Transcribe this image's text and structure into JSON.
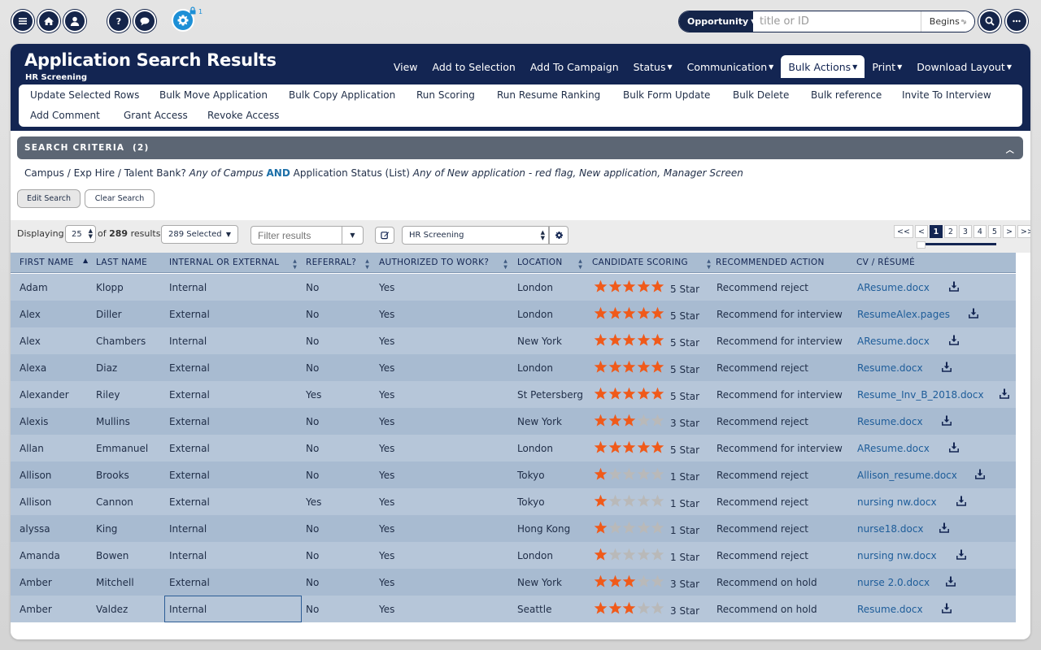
{
  "search": {
    "entity": "Opportunity",
    "placeholder": "title or ID",
    "mode": "Begins"
  },
  "top_icons": [
    "menu-icon",
    "home-icon",
    "user-icon",
    "help-icon",
    "chat-icon",
    "settings-icon"
  ],
  "lock_badge": "1",
  "header": {
    "title": "Application Search Results",
    "subtitle": "HR Screening",
    "menu": [
      {
        "label": "View",
        "caret": false
      },
      {
        "label": "Add to Selection",
        "caret": false
      },
      {
        "label": "Add To Campaign",
        "caret": false
      },
      {
        "label": "Status",
        "caret": true
      },
      {
        "label": "Communication",
        "caret": true
      },
      {
        "label": "Bulk Actions",
        "caret": true,
        "active": true
      },
      {
        "label": "Print",
        "caret": true
      },
      {
        "label": "Download Layout",
        "caret": true
      }
    ]
  },
  "bulk_actions": [
    "Update Selected Rows",
    "Bulk Move Application",
    "Bulk Copy Application",
    "Run Scoring",
    "Run Resume Ranking",
    "Bulk Form Update",
    "Bulk Delete",
    "Bulk reference",
    "Invite To Interview",
    "Add Comment",
    "Grant Access",
    "Revoke Access"
  ],
  "criteria": {
    "heading": "SEARCH CRITERIA",
    "count": "(2)",
    "field1": "Campus / Exp Hire / Talent Bank?",
    "op1": "Any of",
    "val1": "Campus",
    "conj": "AND",
    "field2": "Application Status (List)",
    "op2": "Any of",
    "val2": "New application - red flag, New application, Manager Screen",
    "edit": "Edit Search",
    "clear": "Clear Search"
  },
  "toolbar": {
    "displaying": "Displaying",
    "per_page": "25",
    "of": "of",
    "total": "289",
    "results": "results",
    "selected": "289 Selected",
    "filter_placeholder": "Filter results",
    "view": "HR Screening",
    "pages": [
      "<<",
      "<",
      "1",
      "2",
      "3",
      "4",
      "5",
      ">",
      ">>"
    ],
    "current_page": "1"
  },
  "columns": [
    "FIRST NAME",
    "LAST NAME",
    "INTERNAL OR EXTERNAL",
    "REFERRAL?",
    "AUTHORIZED TO WORK?",
    "LOCATION",
    "CANDIDATE SCORING",
    "RECOMMENDED ACTION",
    "CV / RÉSUMÉ"
  ],
  "rows": [
    {
      "first": "Adam",
      "last": "Klopp",
      "ie": "Internal",
      "ref": "No",
      "auth": "Yes",
      "loc": "London",
      "stars": 5,
      "score": "5 Star",
      "action": "Recommend reject",
      "cv": "AResume.docx"
    },
    {
      "first": "Alex",
      "last": "Diller",
      "ie": "External",
      "ref": "No",
      "auth": "Yes",
      "loc": "London",
      "stars": 5,
      "score": "5 Star",
      "action": "Recommend for interview",
      "cv": "ResumeAlex.pages"
    },
    {
      "first": "Alex",
      "last": "Chambers",
      "ie": "Internal",
      "ref": "No",
      "auth": "Yes",
      "loc": "New York",
      "stars": 5,
      "score": "5 Star",
      "action": "Recommend for interview",
      "cv": "AResume.docx"
    },
    {
      "first": "Alexa",
      "last": "Diaz",
      "ie": "External",
      "ref": "No",
      "auth": "Yes",
      "loc": "London",
      "stars": 5,
      "score": "5 Star",
      "action": "Recommend reject",
      "cv": "Resume.docx"
    },
    {
      "first": "Alexander",
      "last": "Riley",
      "ie": "External",
      "ref": "Yes",
      "auth": "Yes",
      "loc": "St Petersberg",
      "stars": 5,
      "score": "5 Star",
      "action": "Recommend for interview",
      "cv": "Resume_Inv_B_2018.docx"
    },
    {
      "first": "Alexis",
      "last": "Mullins",
      "ie": "External",
      "ref": "No",
      "auth": "Yes",
      "loc": "New York",
      "stars": 3,
      "score": "3 Star",
      "action": "Recommend reject",
      "cv": "Resume.docx"
    },
    {
      "first": "Allan",
      "last": "Emmanuel",
      "ie": "External",
      "ref": "No",
      "auth": "Yes",
      "loc": "London",
      "stars": 5,
      "score": "5 Star",
      "action": "Recommend for interview",
      "cv": "AResume.docx"
    },
    {
      "first": "Allison",
      "last": "Brooks",
      "ie": "External",
      "ref": "No",
      "auth": "Yes",
      "loc": "Tokyo",
      "stars": 1,
      "score": "1 Star",
      "action": "Recommend reject",
      "cv": "Allison_resume.docx"
    },
    {
      "first": "Allison",
      "last": "Cannon",
      "ie": "External",
      "ref": "Yes",
      "auth": "Yes",
      "loc": "Tokyo",
      "stars": 1,
      "score": "1 Star",
      "action": "Recommend reject",
      "cv": "nursing nw.docx"
    },
    {
      "first": "alyssa",
      "last": "King",
      "ie": "Internal",
      "ref": "No",
      "auth": "Yes",
      "loc": "Hong Kong",
      "stars": 1,
      "score": "1 Star",
      "action": "Recommend reject",
      "cv": "nurse18.docx"
    },
    {
      "first": "Amanda",
      "last": "Bowen",
      "ie": "Internal",
      "ref": "No",
      "auth": "Yes",
      "loc": "London",
      "stars": 1,
      "score": "1 Star",
      "action": "Recommend reject",
      "cv": "nursing nw.docx"
    },
    {
      "first": "Amber",
      "last": "Mitchell",
      "ie": "External",
      "ref": "No",
      "auth": "Yes",
      "loc": "New York",
      "stars": 3,
      "score": "3 Star",
      "action": "Recommend on hold",
      "cv": "nurse 2.0.docx"
    },
    {
      "first": "Amber",
      "last": "Valdez",
      "ie": "Internal",
      "ref": "No",
      "auth": "Yes",
      "loc": "Seattle",
      "stars": 3,
      "score": "3 Star",
      "action": "Recommend on hold",
      "cv": "Resume.docx",
      "focused": true
    }
  ],
  "colors": {
    "navy": "#132552",
    "accent_blue": "#1c8fd6",
    "star_on": "#f05a1a",
    "star_off": "#b9b9b9",
    "row_a": "#b6c6d9",
    "row_b": "#a8bbd1",
    "header_bg": "#a9bcd1",
    "criteria_bar": "#5c6674"
  }
}
